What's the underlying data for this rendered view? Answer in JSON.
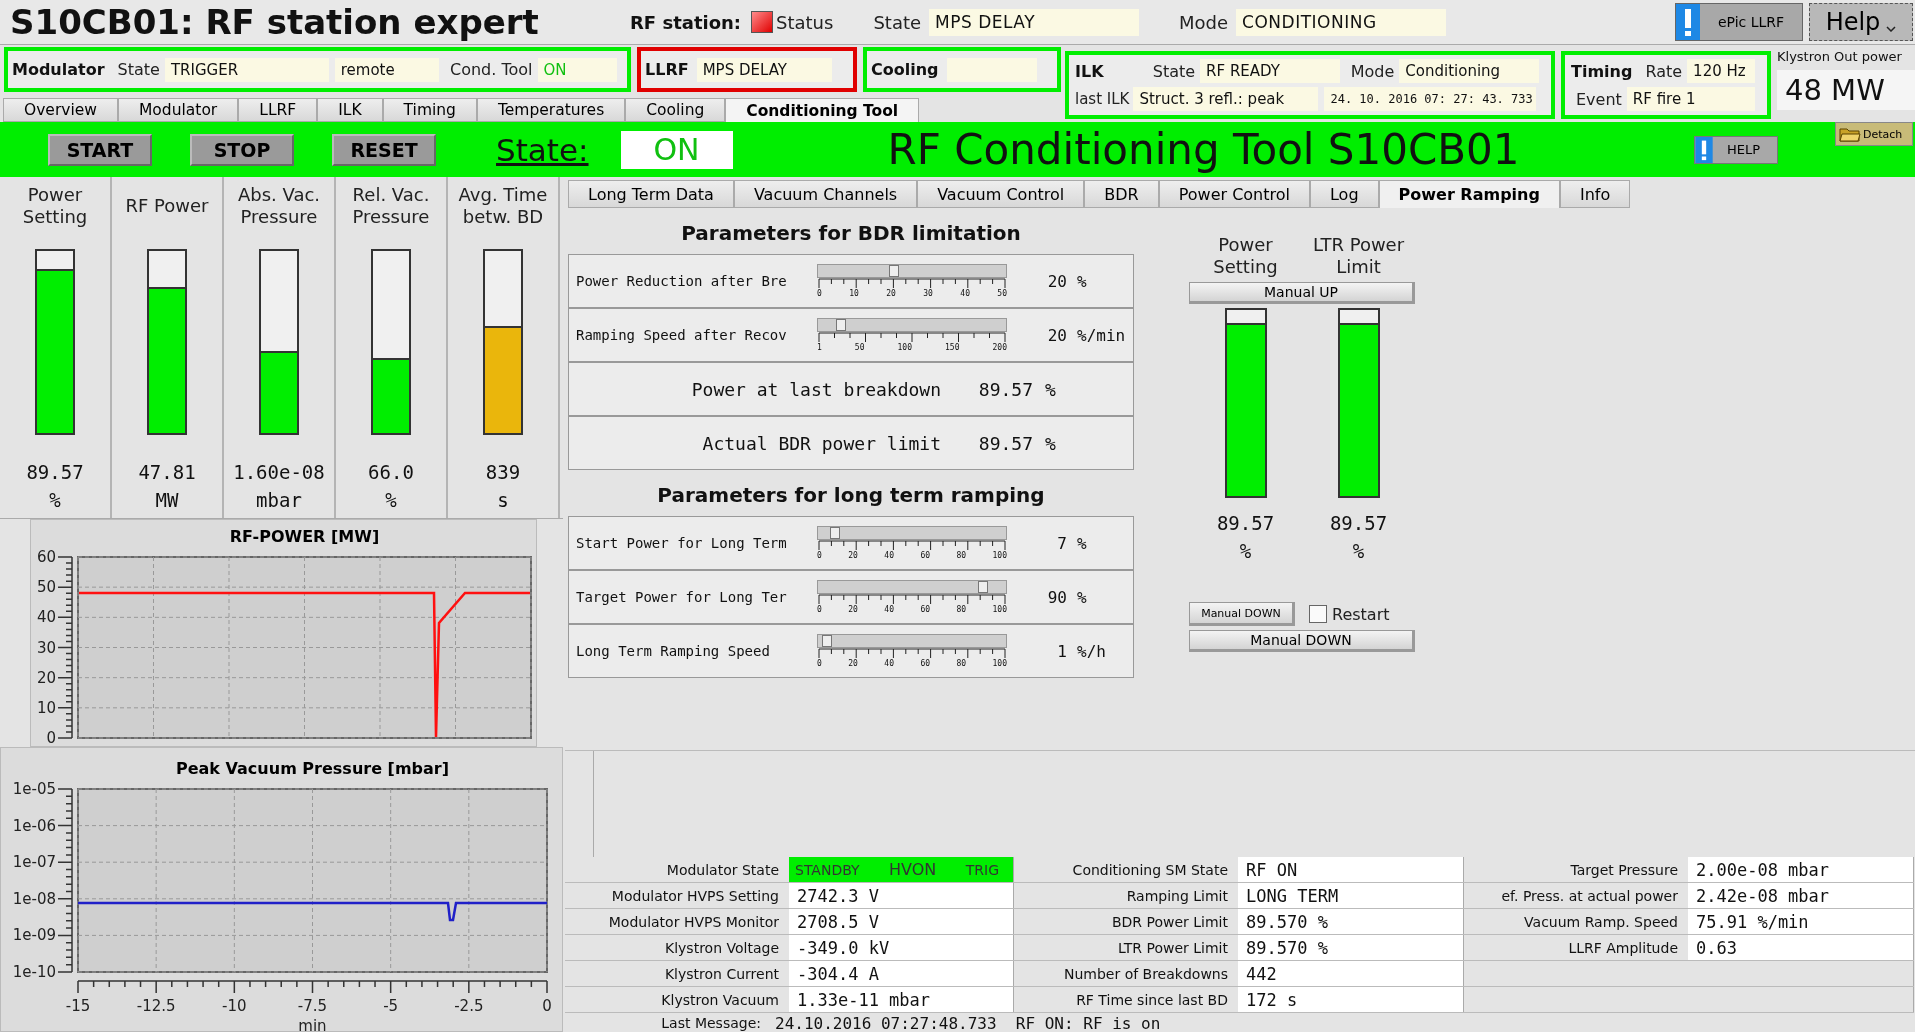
{
  "header": {
    "title": "S10CB01: RF station expert",
    "station_label": "RF station:",
    "status": {
      "label": "Status",
      "alarm": true
    },
    "state_label": "State",
    "state": "MPS DELAY",
    "mode_label": "Mode",
    "mode": "CONDITIONING",
    "epics_button": "ePic LLRF",
    "help_button": "Help"
  },
  "modulator": {
    "title": "Modulator",
    "state_label": "State",
    "state": "TRIGGER",
    "control": "remote",
    "cond_label": "Cond. Tool",
    "cond": "ON",
    "alarm": false
  },
  "llrf": {
    "title": "LLRF",
    "state": "MPS DELAY",
    "alarm": true
  },
  "cooling": {
    "title": "Cooling",
    "alarm": false
  },
  "ilk": {
    "title": "ILK",
    "state_label": "State",
    "state": "RF READY",
    "mode_label": "Mode",
    "mode": "Conditioning",
    "last_label": "last ILK",
    "last": "Struct. 3 refl.: peak",
    "last_time": "24. 10. 2016  07: 27: 43. 733",
    "alarm": false
  },
  "timing": {
    "title": "Timing",
    "rate_label": "Rate",
    "rate": "120 Hz",
    "event_label": "Event",
    "event": "RF fire 1",
    "alarm": false
  },
  "klystron": {
    "label": "Klystron Out power",
    "value": "48 MW"
  },
  "tabs": [
    {
      "label": "Overview",
      "selected": false
    },
    {
      "label": "Modulator",
      "selected": false
    },
    {
      "label": "LLRF",
      "selected": false
    },
    {
      "label": "ILK",
      "selected": false
    },
    {
      "label": "Timing",
      "selected": false
    },
    {
      "label": "Temperatures",
      "selected": false
    },
    {
      "label": "Cooling",
      "selected": false
    },
    {
      "label": "Conditioning Tool",
      "selected": true
    }
  ],
  "tool_bar": {
    "buttons": [
      "START",
      "STOP",
      "RESET"
    ],
    "state_label": "State:",
    "state": "ON",
    "title": "RF Conditioning Tool S10CB01",
    "help_button": "HELP",
    "detach_button": "Detach"
  },
  "meters": [
    {
      "label": "Power Setting",
      "level": 0.9,
      "value": "89.57",
      "unit": "%",
      "color": "#00ee00"
    },
    {
      "label": "RF Power",
      "level": 0.8,
      "value": "47.81",
      "unit": "MW",
      "color": "#00ee00"
    },
    {
      "label": "Abs. Vac. Pressure",
      "level": 0.45,
      "value": "1.60e-08",
      "unit": "mbar",
      "color": "#00ee00"
    },
    {
      "label": "Rel. Vac. Pressure",
      "level": 0.41,
      "value": "66.0",
      "unit": "%",
      "color": "#00ee00"
    },
    {
      "label": "Avg. Time betw. BD",
      "level": 0.59,
      "value": "839",
      "unit": "s",
      "color": "#eab60c"
    }
  ],
  "charts": [
    {
      "title": "RF-POWER [MW]",
      "y_labels": [
        "60",
        "50",
        "40",
        "30",
        "20",
        "10",
        "0"
      ]
    },
    {
      "title": "Peak Vacuum Pressure [mbar]",
      "xlabel": "min",
      "y_labels": [
        "1e-05",
        "1e-06",
        "1e-07",
        "1e-08",
        "1e-09",
        "1e-10"
      ],
      "x_labels": [
        "-15",
        "-12.5",
        "-10",
        "-7.5",
        "-5",
        "-2.5",
        "0"
      ]
    }
  ],
  "subtabs": [
    {
      "label": "Long Term Data",
      "selected": false
    },
    {
      "label": "Vacuum Channels",
      "selected": false
    },
    {
      "label": "Vacuum Control",
      "selected": false
    },
    {
      "label": "BDR",
      "selected": false
    },
    {
      "label": "Power Control",
      "selected": false
    },
    {
      "label": "Log",
      "selected": false
    },
    {
      "label": "Power Ramping",
      "selected": true
    },
    {
      "label": "Info",
      "selected": false
    }
  ],
  "sections": [
    {
      "title": "Parameters for BDR limitation",
      "rows": [
        {
          "kind": "slider",
          "label": "Power Reduction after Bre",
          "level": 0.4,
          "ticks": [
            "0",
            "10",
            "20",
            "30",
            "40",
            "50"
          ],
          "value": "20",
          "unit": "%"
        },
        {
          "kind": "slider",
          "label": "Ramping Speed after Recov",
          "level": 0.1,
          "ticks": [
            "1",
            "50",
            "100",
            "150",
            "200"
          ],
          "value": "20",
          "unit": "%/min"
        },
        {
          "kind": "readout",
          "label": "Power at last breakdown",
          "value": "89.57",
          "unit": "%"
        },
        {
          "kind": "readout",
          "label": "Actual BDR power limit",
          "value": "89.57",
          "unit": "%"
        }
      ]
    },
    {
      "title": "Parameters for long term ramping",
      "rows": [
        {
          "kind": "slider",
          "label": "Start Power for Long Term",
          "level": 0.07,
          "ticks": [
            "0",
            "20",
            "40",
            "60",
            "80",
            "100"
          ],
          "value": "7",
          "unit": "%"
        },
        {
          "kind": "slider",
          "label": "Target Power for Long Ter",
          "level": 0.9,
          "ticks": [
            "0",
            "20",
            "40",
            "60",
            "80",
            "100"
          ],
          "value": "90",
          "unit": "%"
        },
        {
          "kind": "slider",
          "label": "Long Term Ramping Speed",
          "level": 0.02,
          "ticks": [
            "0",
            "20",
            "40",
            "60",
            "80",
            "100"
          ],
          "value": "1",
          "unit": "%/h"
        }
      ]
    }
  ],
  "ramping": {
    "up_button": "Manual UP",
    "bars": [
      {
        "label": "Power Setting",
        "level": 0.93,
        "value": "89.57",
        "unit": "%"
      },
      {
        "label": "LTR Power Limit",
        "level": 0.93,
        "value": "89.57",
        "unit": "%"
      }
    ],
    "down_button_small": "Manual DOWN",
    "restart": {
      "label": "Restart",
      "checked": false
    },
    "down_button": "Manual DOWN"
  },
  "status_table": [
    {
      "rows": [
        {
          "label": "Modulator State",
          "flags": [
            "STANDBY",
            "HVON",
            "TRIG"
          ]
        },
        {
          "label": "Modulator HVPS Setting",
          "value": "2742.3 V"
        },
        {
          "label": "Modulator HVPS Monitor",
          "value": "2708.5 V"
        },
        {
          "label": "Klystron Voltage",
          "value": "-349.0 kV"
        },
        {
          "label": "Klystron Current",
          "value": "-304.4 A"
        },
        {
          "label": "Klystron Vacuum",
          "value": "1.33e-11 mbar"
        }
      ]
    },
    {
      "rows": [
        {
          "label": "Conditioning SM State",
          "value": "RF ON"
        },
        {
          "label": "Ramping Limit",
          "value": "LONG TERM"
        },
        {
          "label": "BDR Power Limit",
          "value": "89.570 %"
        },
        {
          "label": "LTR Power Limit",
          "value": "89.570 %"
        },
        {
          "label": "Number of Breakdowns",
          "value": "442"
        },
        {
          "label": "RF Time since last BD",
          "value": "172 s"
        }
      ]
    },
    {
      "rows": [
        {
          "label": "Target Pressure",
          "value": "2.00e-08 mbar"
        },
        {
          "label": "ef. Press. at actual power",
          "value": "2.42e-08 mbar"
        },
        {
          "label": "Vacuum Ramp. Speed",
          "value": "75.91 %/min"
        },
        {
          "label": "LLRF Amplitude",
          "value": "0.63"
        }
      ]
    }
  ],
  "last_message": {
    "label": "Last Message:",
    "value": "24.10.2016 07:27:48.733  RF ON: RF is on"
  }
}
